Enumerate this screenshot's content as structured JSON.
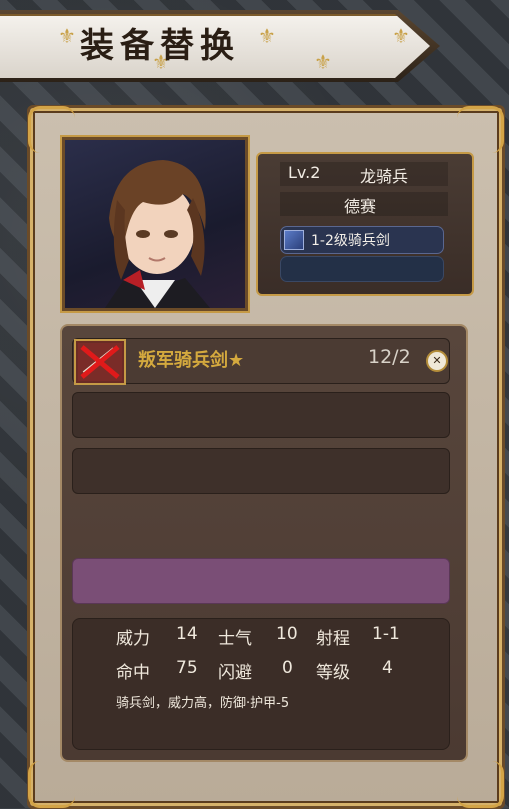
{
  "title": "装备替换",
  "unit": {
    "level": "Lv.2",
    "class": "龙骑兵",
    "name": "德赛",
    "equipped_weapon": "1-2级骑兵剑"
  },
  "item": {
    "name": "叛军骑兵剑★",
    "durability": "12/2"
  },
  "stats": {
    "power_label": "威力",
    "power": "14",
    "morale_label": "士气",
    "morale": "10",
    "range_label": "射程",
    "range": "1-1",
    "hit_label": "命中",
    "hit": "75",
    "evade_label": "闪避",
    "evade": "0",
    "grade_label": "等级",
    "grade": "4"
  },
  "description": "骑兵剑，威力高，防御·护甲-5",
  "colors": {
    "item_name": "#d4a93e",
    "selected_row": "#7a4e76",
    "frame_gold": "#c59a46"
  },
  "icons": {
    "item": "crossed-out-sword-icon",
    "weapon": "sword-icon",
    "close": "close-icon"
  }
}
